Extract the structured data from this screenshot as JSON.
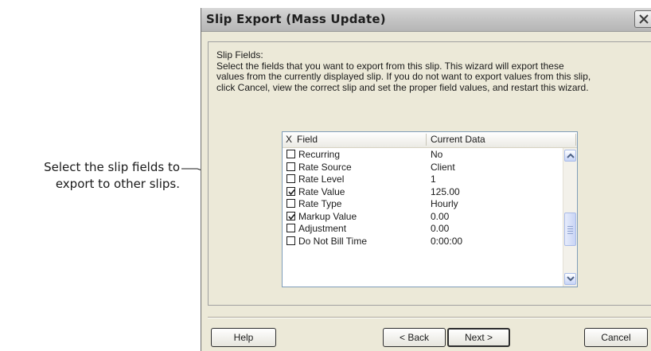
{
  "callout": {
    "line1": "Select the slip fields to",
    "line2": "export to other slips."
  },
  "window": {
    "title": "Slip Export (Mass Update)",
    "close_icon": "close-icon"
  },
  "intro": {
    "label": "Slip Fields:",
    "line1": "Select the fields that you want to export from this slip. This wizard will export these",
    "line2": "values from the currently displayed slip. If you do not want to export values from this slip,",
    "line3": "click Cancel, view the correct slip and set the proper field values, and restart this wizard."
  },
  "list": {
    "header": {
      "check_col": "X",
      "field_col": "Field",
      "data_col": "Current Data"
    },
    "rows": [
      {
        "field": "Recurring",
        "data": "No",
        "checked": false
      },
      {
        "field": "Rate Source",
        "data": "Client",
        "checked": false
      },
      {
        "field": "Rate Level",
        "data": "1",
        "checked": false
      },
      {
        "field": "Rate Value",
        "data": "125.00",
        "checked": true
      },
      {
        "field": "Rate Type",
        "data": "Hourly",
        "checked": false
      },
      {
        "field": "Markup Value",
        "data": "0.00",
        "checked": true
      },
      {
        "field": "Adjustment",
        "data": "0.00",
        "checked": false
      },
      {
        "field": "Do Not Bill Time",
        "data": "0:00:00",
        "checked": false
      }
    ]
  },
  "buttons": {
    "help": "Help",
    "back": "< Back",
    "next": "Next >",
    "cancel": "Cancel"
  },
  "colors": {
    "dialog_bg": "#ece9d8",
    "list_border": "#7f9db9",
    "scrollbar_accent": "#c6d3f7"
  }
}
